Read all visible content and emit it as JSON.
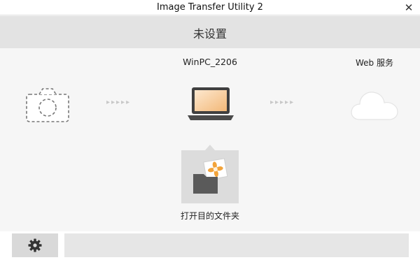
{
  "window": {
    "title": "Image Transfer Utility 2",
    "close_glyph": "✕"
  },
  "header": {
    "status": "未设置"
  },
  "devices": {
    "pc_name": "WinPC_2206",
    "web_service": "Web 服务",
    "arrow_glyphs": "▸▸▸▸▸"
  },
  "folder": {
    "label": "打开目的文件夹"
  },
  "icons": {
    "camera": "camera-icon",
    "laptop": "laptop-icon",
    "cloud": "cloud-icon",
    "folder": "folder-icon",
    "settings": "gear-icon"
  },
  "colors": {
    "folder_flower": "#f2a33a",
    "laptop_screen": "#f6c78e"
  }
}
